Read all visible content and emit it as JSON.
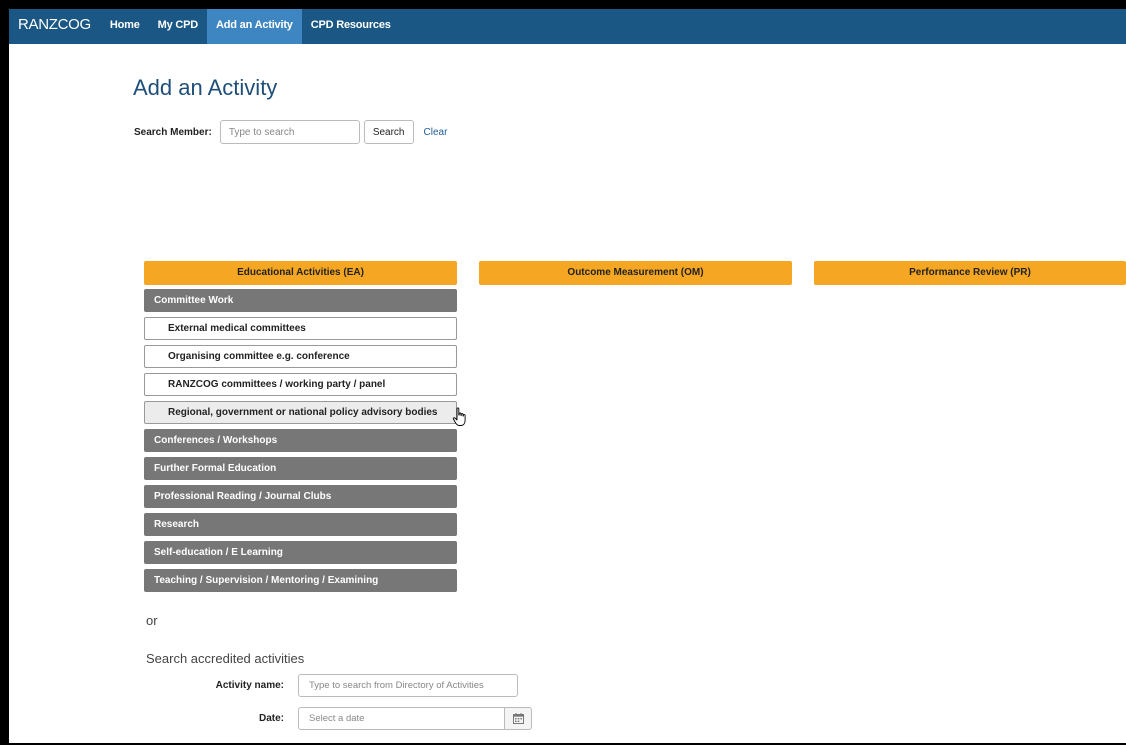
{
  "navbar": {
    "brand": "RANZCOG",
    "items": [
      {
        "label": "Home"
      },
      {
        "label": "My CPD"
      },
      {
        "label": "Add an Activity",
        "active": true
      },
      {
        "label": "CPD Resources"
      }
    ]
  },
  "page": {
    "title": "Add an Activity"
  },
  "member_search": {
    "label": "Search Member:",
    "placeholder": "Type to search",
    "value": "",
    "search_button": "Search",
    "clear_link": "Clear"
  },
  "columns": {
    "ea": "Educational Activities (EA)",
    "om": "Outcome Measurement (OM)",
    "pr": "Performance Review (PR)"
  },
  "ea_list": {
    "committee_work": {
      "label": "Committee Work",
      "expanded": true,
      "subitems": [
        {
          "label": "External medical committees"
        },
        {
          "label": "Organising committee e.g. conference"
        },
        {
          "label": "RANZCOG committees / working party / panel"
        },
        {
          "label": "Regional, government or national policy advisory bodies",
          "hovered": true
        }
      ]
    },
    "other_categories": [
      {
        "label": "Conferences / Workshops"
      },
      {
        "label": "Further Formal Education"
      },
      {
        "label": "Professional Reading / Journal Clubs"
      },
      {
        "label": "Research"
      },
      {
        "label": "Self-education / E Learning"
      },
      {
        "label": "Teaching / Supervision / Mentoring / Examining"
      }
    ]
  },
  "or_text": "or",
  "accredited_search": {
    "title": "Search accredited activities",
    "activity_name_label": "Activity name:",
    "activity_name_placeholder": "Type to search from Directory of Activities",
    "date_label": "Date:",
    "date_placeholder": "Select a date"
  },
  "colors": {
    "navbar": "#1a5784",
    "nav_active": "#3e86c1",
    "column_header": "#f5a623",
    "category": "#777777",
    "title": "#1f4e79"
  },
  "icons": [
    "hand-pointer-icon",
    "calendar-icon"
  ]
}
